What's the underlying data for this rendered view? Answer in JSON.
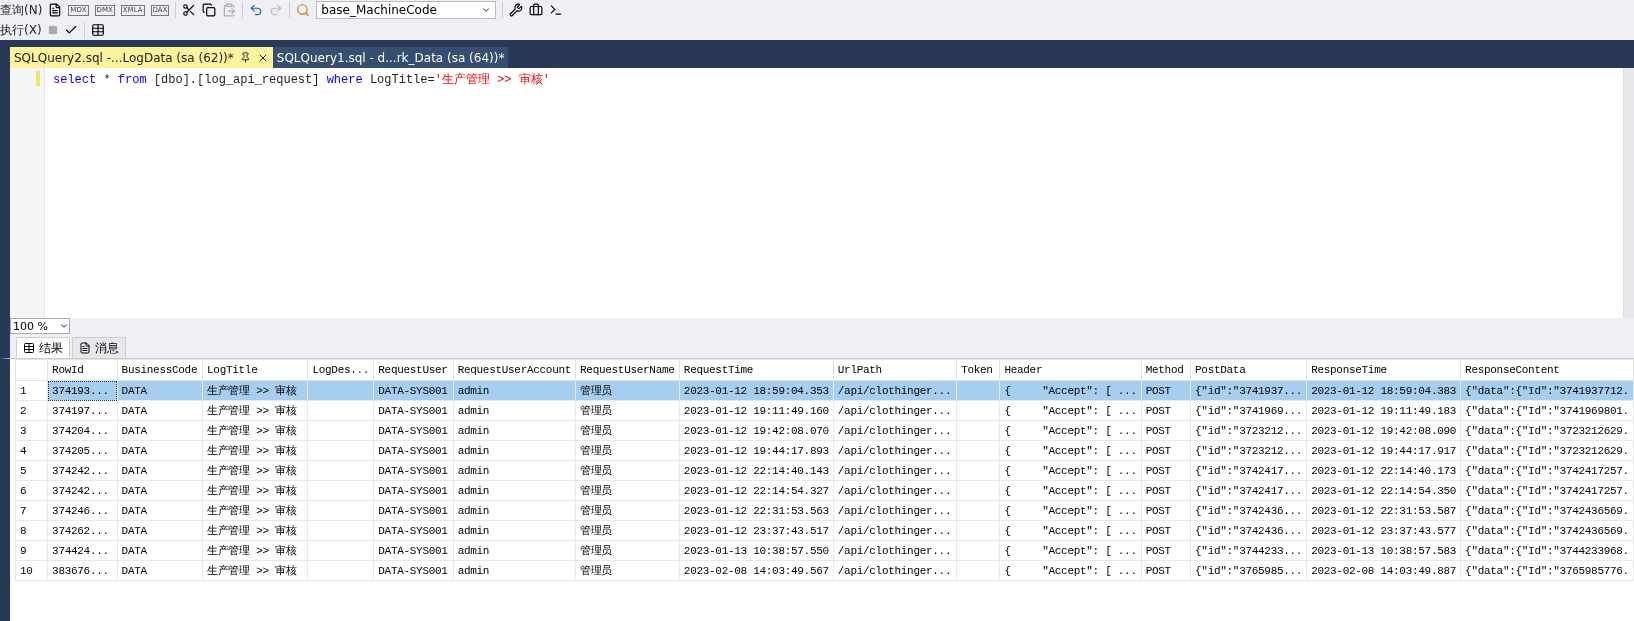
{
  "toolbar": {
    "new_query_label": "查询(N)",
    "query_type_labels": [
      "MDX",
      "DMX",
      "XMLA",
      "DAX"
    ],
    "database": "base_MachineCode",
    "execute_label": "执行(X)"
  },
  "tabs": [
    {
      "label": "SQLQuery2.sql -...LogData (sa (62))*",
      "selected": true
    },
    {
      "label": "SQLQuery1.sql - d...rk_Data (sa (64))*",
      "selected": false
    }
  ],
  "editor": {
    "lines": [
      [
        {
          "text": "select",
          "kind": "keyword"
        },
        {
          "text": " * ",
          "kind": "plain"
        },
        {
          "text": "from",
          "kind": "keyword"
        },
        {
          "text": " [dbo].[log_api_request] ",
          "kind": "plain"
        },
        {
          "text": "where",
          "kind": "keyword"
        },
        {
          "text": " LogTitle=",
          "kind": "plain"
        },
        {
          "text": "'生产管理 >> 审核'",
          "kind": "string"
        }
      ]
    ]
  },
  "zoom": "100 %",
  "result_tabs": [
    {
      "label": "结果",
      "selected": true
    },
    {
      "label": "消息",
      "selected": false
    }
  ],
  "table": {
    "columns": [
      "RowId",
      "BusinessCode",
      "LogTitle",
      "LogDes...",
      "RequestUser",
      "RequestUserAccount",
      "RequestUserName",
      "RequestTime",
      "UrlPath",
      "Token",
      "Header",
      "Method",
      "PostData",
      "ResponseTime",
      "ResponseContent"
    ],
    "rows": [
      {
        "number": "1",
        "selected": true,
        "cells": [
          "374193...",
          "DATA",
          "生产管理 >> 审核",
          "",
          "DATA-SYS001",
          "admin",
          "管理员",
          "2023-01-12 18:59:04.353",
          "/api/clothinger...",
          "",
          "{     \"Accept\": [ ...",
          "POST",
          "{\"id\":\"3741937...",
          "2023-01-12 18:59:04.383",
          "{\"data\":{\"Id\":\"3741937712."
        ]
      },
      {
        "number": "2",
        "selected": false,
        "cells": [
          "374197...",
          "DATA",
          "生产管理 >> 审核",
          "",
          "DATA-SYS001",
          "admin",
          "管理员",
          "2023-01-12 19:11:49.160",
          "/api/clothinger...",
          "",
          "{     \"Accept\": [ ...",
          "POST",
          "{\"id\":\"3741969...",
          "2023-01-12 19:11:49.183",
          "{\"data\":{\"Id\":\"3741969801."
        ]
      },
      {
        "number": "3",
        "selected": false,
        "cells": [
          "374204...",
          "DATA",
          "生产管理 >> 审核",
          "",
          "DATA-SYS001",
          "admin",
          "管理员",
          "2023-01-12 19:42:08.070",
          "/api/clothinger...",
          "",
          "{     \"Accept\": [ ...",
          "POST",
          "{\"id\":\"3723212...",
          "2023-01-12 19:42:08.090",
          "{\"data\":{\"Id\":\"3723212629."
        ]
      },
      {
        "number": "4",
        "selected": false,
        "cells": [
          "374205...",
          "DATA",
          "生产管理 >> 审核",
          "",
          "DATA-SYS001",
          "admin",
          "管理员",
          "2023-01-12 19:44:17.893",
          "/api/clothinger...",
          "",
          "{     \"Accept\": [ ...",
          "POST",
          "{\"id\":\"3723212...",
          "2023-01-12 19:44:17.917",
          "{\"data\":{\"Id\":\"3723212629."
        ]
      },
      {
        "number": "5",
        "selected": false,
        "cells": [
          "374242...",
          "DATA",
          "生产管理 >> 审核",
          "",
          "DATA-SYS001",
          "admin",
          "管理员",
          "2023-01-12 22:14:40.143",
          "/api/clothinger...",
          "",
          "{     \"Accept\": [ ...",
          "POST",
          "{\"id\":\"3742417...",
          "2023-01-12 22:14:40.173",
          "{\"data\":{\"Id\":\"3742417257."
        ]
      },
      {
        "number": "6",
        "selected": false,
        "cells": [
          "374242...",
          "DATA",
          "生产管理 >> 审核",
          "",
          "DATA-SYS001",
          "admin",
          "管理员",
          "2023-01-12 22:14:54.327",
          "/api/clothinger...",
          "",
          "{     \"Accept\": [ ...",
          "POST",
          "{\"id\":\"3742417...",
          "2023-01-12 22:14:54.350",
          "{\"data\":{\"Id\":\"3742417257."
        ]
      },
      {
        "number": "7",
        "selected": false,
        "cells": [
          "374246...",
          "DATA",
          "生产管理 >> 审核",
          "",
          "DATA-SYS001",
          "admin",
          "管理员",
          "2023-01-12 22:31:53.563",
          "/api/clothinger...",
          "",
          "{     \"Accept\": [ ...",
          "POST",
          "{\"id\":\"3742436...",
          "2023-01-12 22:31:53.587",
          "{\"data\":{\"Id\":\"3742436569."
        ]
      },
      {
        "number": "8",
        "selected": false,
        "cells": [
          "374262...",
          "DATA",
          "生产管理 >> 审核",
          "",
          "DATA-SYS001",
          "admin",
          "管理员",
          "2023-01-12 23:37:43.517",
          "/api/clothinger...",
          "",
          "{     \"Accept\": [ ...",
          "POST",
          "{\"id\":\"3742436...",
          "2023-01-12 23:37:43.577",
          "{\"data\":{\"Id\":\"3742436569."
        ]
      },
      {
        "number": "9",
        "selected": false,
        "cells": [
          "374424...",
          "DATA",
          "生产管理 >> 审核",
          "",
          "DATA-SYS001",
          "admin",
          "管理员",
          "2023-01-13 10:38:57.550",
          "/api/clothinger...",
          "",
          "{     \"Accept\": [ ...",
          "POST",
          "{\"id\":\"3744233...",
          "2023-01-13 10:38:57.583",
          "{\"data\":{\"Id\":\"3744233968."
        ]
      },
      {
        "number": "10",
        "selected": false,
        "cells": [
          "383676...",
          "DATA",
          "生产管理 >> 审核",
          "",
          "DATA-SYS001",
          "admin",
          "管理员",
          "2023-02-08 14:03:49.567",
          "/api/clothinger...",
          "",
          "{     \"Accept\": [ ...",
          "POST",
          "{\"id\":\"3765985...",
          "2023-02-08 14:03:49.887",
          "{\"data\":{\"Id\":\"3765985776."
        ]
      }
    ]
  }
}
